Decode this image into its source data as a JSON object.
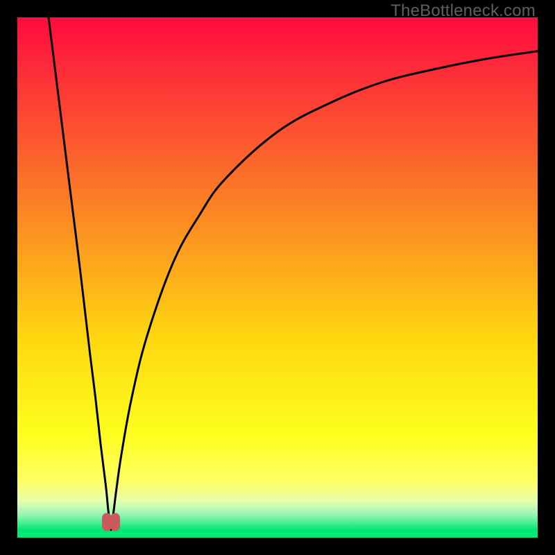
{
  "watermark": "TheBottleneck.com",
  "colors": {
    "gradient_top": "#fe0b40",
    "gradient_mid_upper": "#fb6d2a",
    "gradient_mid": "#fed810",
    "gradient_pale": "#feff68",
    "gradient_pale2": "#e7ffb0",
    "gradient_green": "#02e874",
    "curve": "#000000",
    "marker": "#c95a5d",
    "frame": "#000000"
  },
  "chart_data": {
    "type": "line",
    "title": "",
    "xlabel": "",
    "ylabel": "",
    "xlim": [
      0,
      100
    ],
    "ylim": [
      0,
      100
    ],
    "minimum_x": 18,
    "series": [
      {
        "name": "bottleneck-curve-left",
        "x": [
          6,
          8,
          10,
          12,
          14,
          15,
          16,
          17,
          17.5,
          18
        ],
        "y": [
          100,
          84,
          68,
          52,
          35,
          27,
          18,
          10,
          5,
          1.5
        ]
      },
      {
        "name": "bottleneck-curve-right",
        "x": [
          18,
          18.5,
          19,
          20,
          22,
          25,
          30,
          35,
          40,
          50,
          60,
          70,
          80,
          90,
          100
        ],
        "y": [
          1.5,
          5,
          9,
          16,
          27,
          39,
          53,
          62,
          69,
          78,
          83.5,
          87.5,
          90,
          92,
          93.5
        ]
      },
      {
        "name": "minimum-markers",
        "x": [
          17.2,
          18.8
        ],
        "y": [
          3,
          3
        ]
      }
    ],
    "background_gradient_stops": [
      {
        "pos": 0.0,
        "color": "#fe0b40"
      },
      {
        "pos": 0.3,
        "color": "#fb6d2a"
      },
      {
        "pos": 0.62,
        "color": "#fed810"
      },
      {
        "pos": 0.8,
        "color": "#fefe1d"
      },
      {
        "pos": 0.895,
        "color": "#feff68"
      },
      {
        "pos": 0.93,
        "color": "#e7ffb0"
      },
      {
        "pos": 0.955,
        "color": "#9af6b6"
      },
      {
        "pos": 0.985,
        "color": "#02e874"
      },
      {
        "pos": 1.0,
        "color": "#02e874"
      }
    ]
  }
}
